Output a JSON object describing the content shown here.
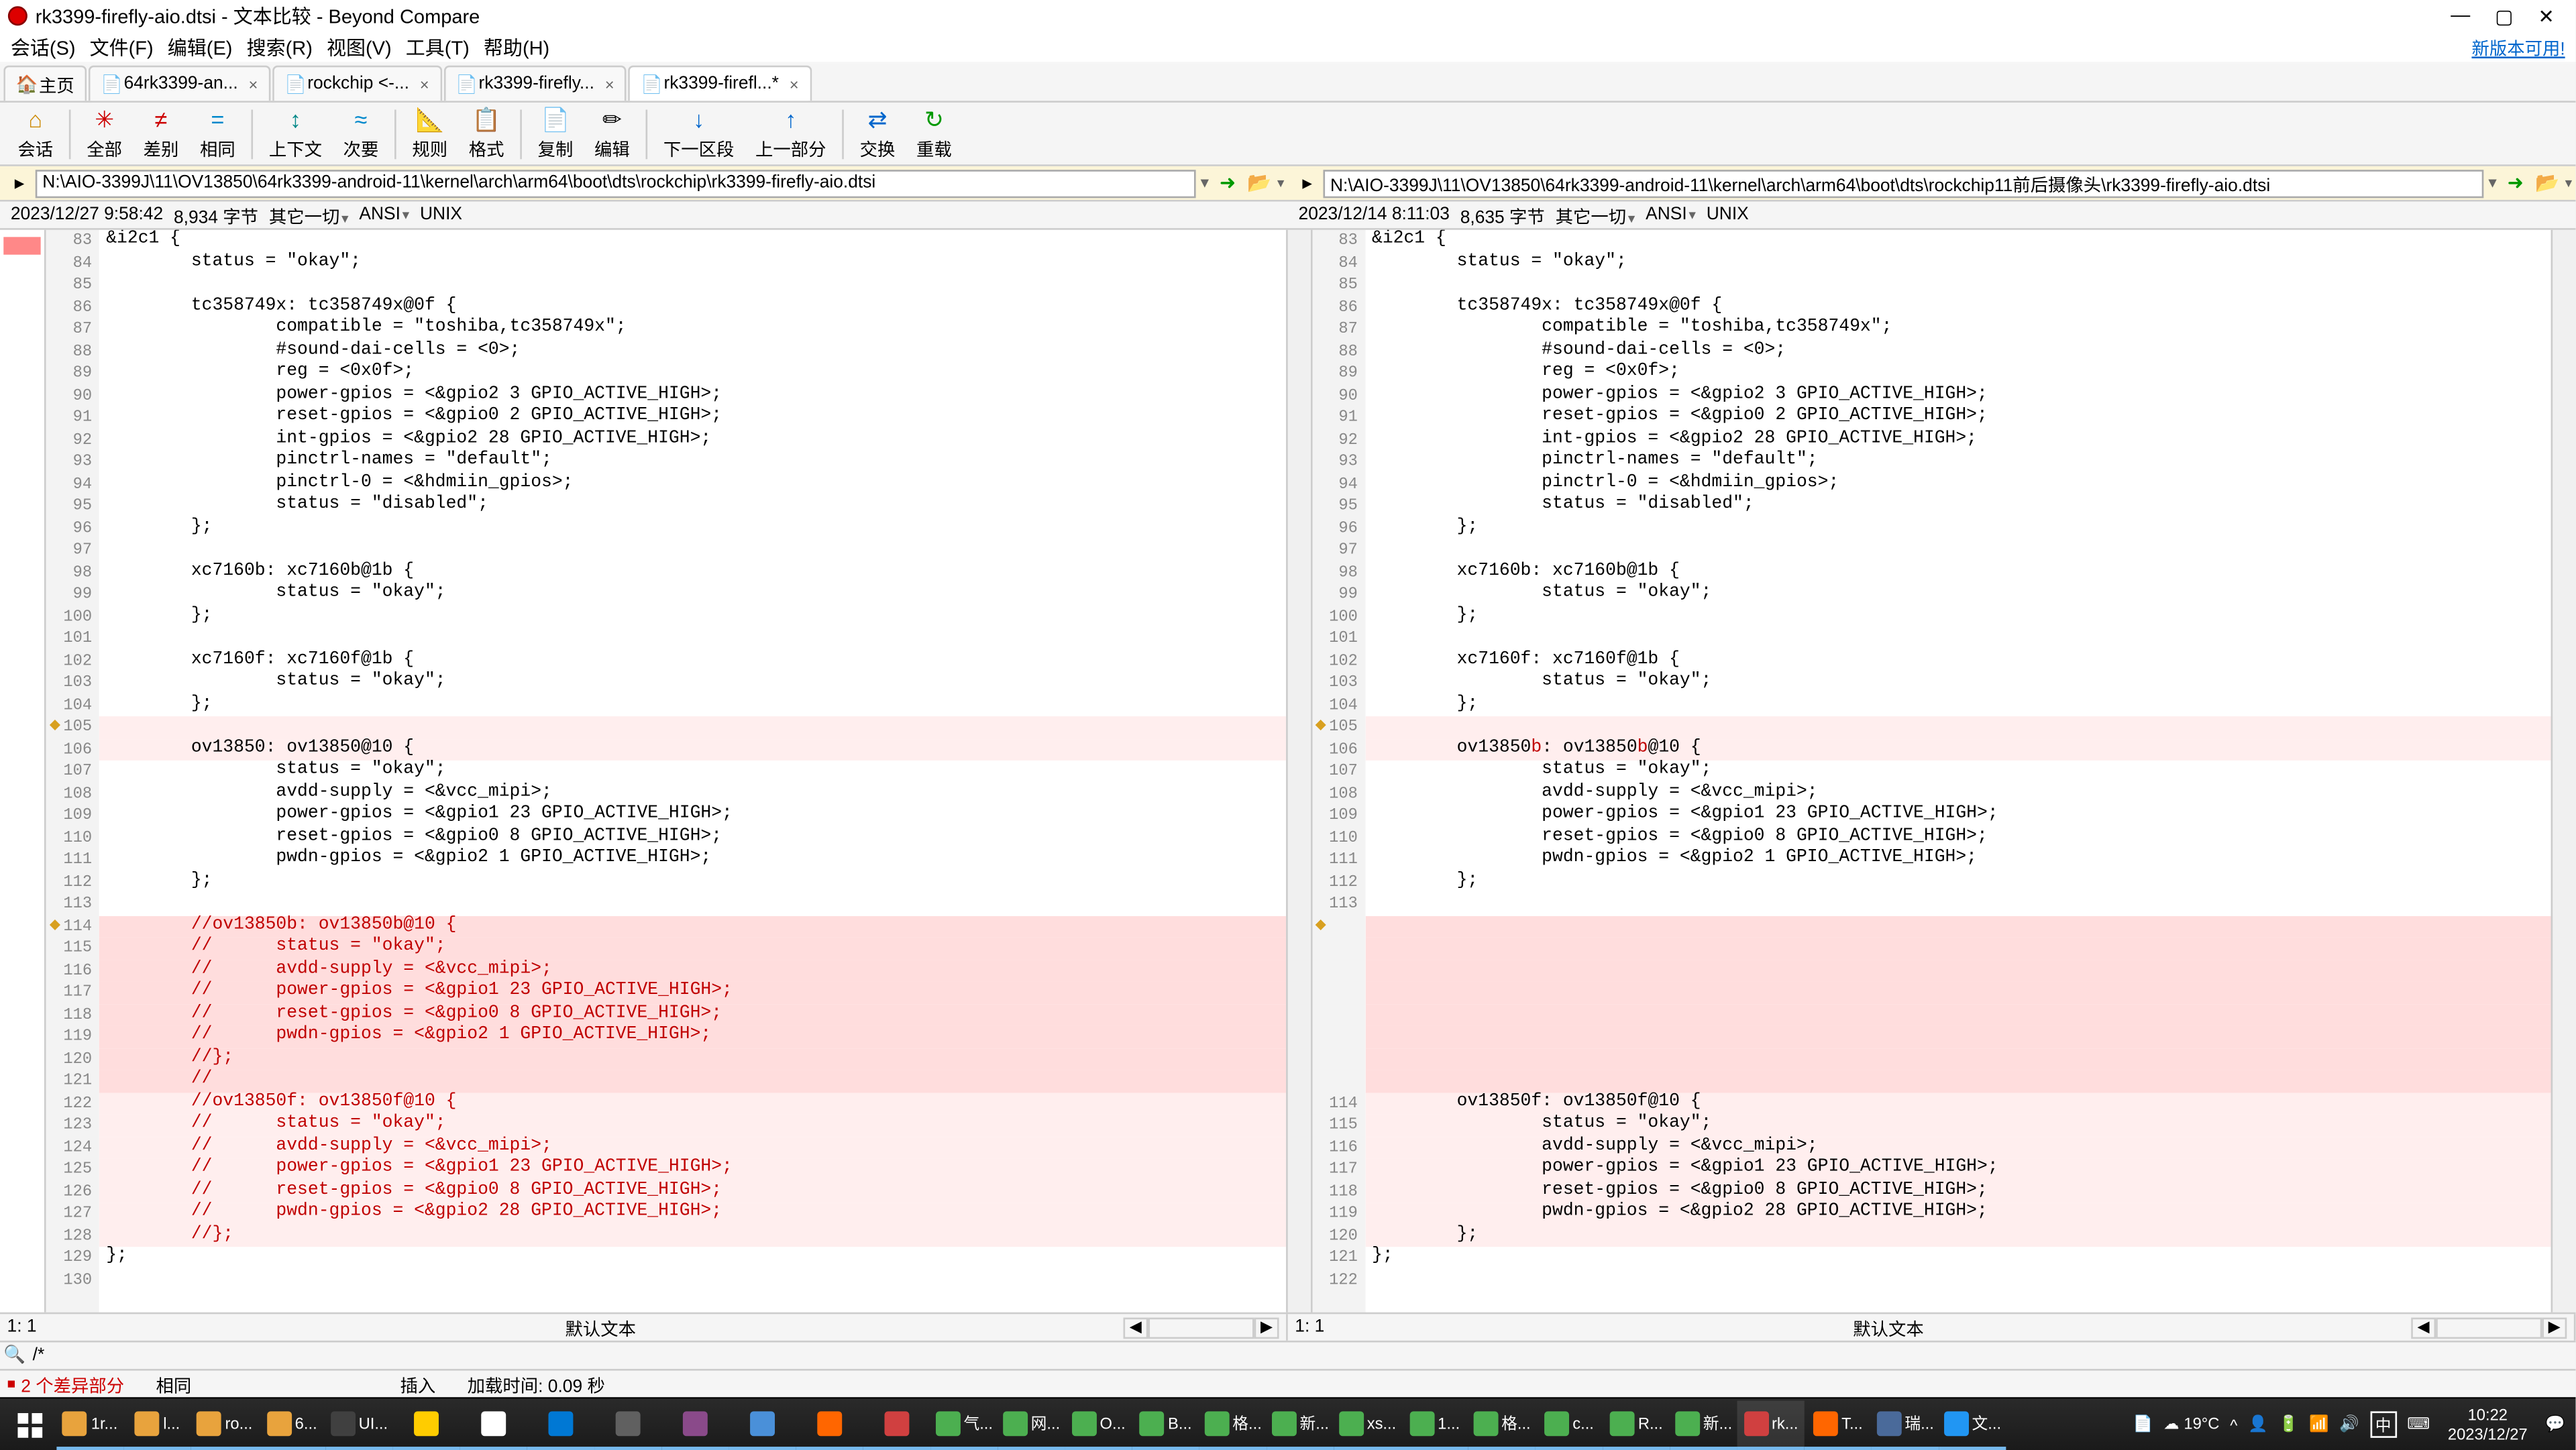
{
  "title": "rk3399-firefly-aio.dtsi - 文本比较 - Beyond Compare",
  "menu": {
    "session": "会话(S)",
    "file": "文件(F)",
    "edit": "编辑(E)",
    "search": "搜索(R)",
    "view": "视图(V)",
    "tools": "工具(T)",
    "help": "帮助(H)"
  },
  "newversion": "新版本可用!",
  "tabs": {
    "home": "主页",
    "t1": "64rk3399-an...",
    "t2": "rockchip <-...",
    "t3": "rk3399-firefly...",
    "t4": "rk3399-firefl...*"
  },
  "toolbar": {
    "session": "会话",
    "all": "全部",
    "diff": "差别",
    "same": "相同",
    "context": "上下文",
    "next": "次要",
    "rule": "规则",
    "format": "格式",
    "copy": "复制",
    "edit": "编辑",
    "nextsec": "下一区段",
    "prevsec": "上一部分",
    "swap": "交换",
    "reload": "重载"
  },
  "path": {
    "left": "N:\\AIO-3399J\\11\\OV13850\\64rk3399-android-11\\kernel\\arch\\arm64\\boot\\dts\\rockchip\\rk3399-firefly-aio.dtsi",
    "right": "N:\\AIO-3399J\\11\\OV13850\\64rk3399-android-11\\kernel\\arch\\arm64\\boot\\dts\\rockchip11前后摄像头\\rk3399-firefly-aio.dtsi"
  },
  "info": {
    "left_ts": "2023/12/27 9:58:42",
    "left_size": "8,934 字节",
    "left_other": "其它一切",
    "left_enc": "ANSI",
    "left_eol": "UNIX",
    "right_ts": "2023/12/14 8:11:03",
    "right_size": "8,635 字节",
    "right_other": "其它一切",
    "right_enc": "ANSI",
    "right_eol": "UNIX"
  },
  "bottom": {
    "pos": "1: 1",
    "mode": "默认文本"
  },
  "search": {
    "magnify": "🔍",
    "regex": "/*"
  },
  "status": {
    "diffcount": "2 个差异部分",
    "same": "相同",
    "insert": "插入",
    "loadtime": "加载时间: 0.09 秒"
  },
  "taskbar": {
    "items": [
      "1r...",
      "l...",
      "ro...",
      "6...",
      "UI...",
      "",
      "",
      "",
      "",
      "",
      "",
      "",
      "",
      "气...",
      "网...",
      "O...",
      "B...",
      "格...",
      "新...",
      "xs...",
      "1...",
      "格...",
      "c...",
      "R...",
      "新...",
      "rk...",
      "T...",
      "瑞...",
      "文..."
    ],
    "weather": "19°C",
    "ime": "中",
    "time": "10:22",
    "date": "2023/12/27"
  },
  "left_lines": [
    {
      "n": 83,
      "bg": "",
      "t": "&i2c1 {"
    },
    {
      "n": 84,
      "bg": "",
      "t": "        status = \"okay\";"
    },
    {
      "n": 85,
      "bg": "",
      "t": ""
    },
    {
      "n": 86,
      "bg": "",
      "t": "        tc358749x: tc358749x@0f {"
    },
    {
      "n": 87,
      "bg": "",
      "t": "                compatible = \"toshiba,tc358749x\";"
    },
    {
      "n": 88,
      "bg": "",
      "t": "                #sound-dai-cells = <0>;"
    },
    {
      "n": 89,
      "bg": "",
      "t": "                reg = <0x0f>;"
    },
    {
      "n": 90,
      "bg": "",
      "t": "                power-gpios = <&gpio2 3 GPIO_ACTIVE_HIGH>;"
    },
    {
      "n": 91,
      "bg": "",
      "t": "                reset-gpios = <&gpio0 2 GPIO_ACTIVE_HIGH>;"
    },
    {
      "n": 92,
      "bg": "",
      "t": "                int-gpios = <&gpio2 28 GPIO_ACTIVE_HIGH>;"
    },
    {
      "n": 93,
      "bg": "",
      "t": "                pinctrl-names = \"default\";"
    },
    {
      "n": 94,
      "bg": "",
      "t": "                pinctrl-0 = <&hdmiin_gpios>;"
    },
    {
      "n": 95,
      "bg": "",
      "t": "                status = \"disabled\";"
    },
    {
      "n": 96,
      "bg": "",
      "t": "        };"
    },
    {
      "n": 97,
      "bg": "",
      "t": ""
    },
    {
      "n": 98,
      "bg": "",
      "t": "        xc7160b: xc7160b@1b {"
    },
    {
      "n": 99,
      "bg": "",
      "t": "                status = \"okay\";"
    },
    {
      "n": 100,
      "bg": "",
      "t": "        };"
    },
    {
      "n": 101,
      "bg": "",
      "t": ""
    },
    {
      "n": 102,
      "bg": "",
      "t": "        xc7160f: xc7160f@1b {"
    },
    {
      "n": 103,
      "bg": "",
      "t": "                status = \"okay\";"
    },
    {
      "n": 104,
      "bg": "",
      "t": "        };"
    },
    {
      "n": 105,
      "bg": "bg-lightpink",
      "t": "",
      "mark": true
    },
    {
      "n": 106,
      "bg": "bg-lightpink",
      "t": "        ov13850: ov13850@10 {"
    },
    {
      "n": 107,
      "bg": "",
      "t": "                status = \"okay\";"
    },
    {
      "n": 108,
      "bg": "",
      "t": "                avdd-supply = <&vcc_mipi>;"
    },
    {
      "n": 109,
      "bg": "",
      "t": "                power-gpios = <&gpio1 23 GPIO_ACTIVE_HIGH>;"
    },
    {
      "n": 110,
      "bg": "",
      "t": "                reset-gpios = <&gpio0 8 GPIO_ACTIVE_HIGH>;"
    },
    {
      "n": 111,
      "bg": "",
      "t": "                pwdn-gpios = <&gpio2 1 GPIO_ACTIVE_HIGH>;"
    },
    {
      "n": 112,
      "bg": "",
      "t": "        };"
    },
    {
      "n": 113,
      "bg": "",
      "t": ""
    },
    {
      "n": 114,
      "bg": "bg-pink",
      "cls": "comment",
      "t": "        //ov13850b: ov13850b@10 {",
      "mark": true
    },
    {
      "n": 115,
      "bg": "bg-pink",
      "cls": "comment",
      "t": "        //      status = \"okay\";"
    },
    {
      "n": 116,
      "bg": "bg-pink",
      "cls": "comment",
      "t": "        //      avdd-supply = <&vcc_mipi>;"
    },
    {
      "n": 117,
      "bg": "bg-pink",
      "cls": "comment",
      "t": "        //      power-gpios = <&gpio1 23 GPIO_ACTIVE_HIGH>;"
    },
    {
      "n": 118,
      "bg": "bg-pink",
      "cls": "comment",
      "t": "        //      reset-gpios = <&gpio0 8 GPIO_ACTIVE_HIGH>;"
    },
    {
      "n": 119,
      "bg": "bg-pink",
      "cls": "comment",
      "t": "        //      pwdn-gpios = <&gpio2 1 GPIO_ACTIVE_HIGH>;"
    },
    {
      "n": 120,
      "bg": "bg-pink",
      "cls": "comment",
      "t": "        //};"
    },
    {
      "n": 121,
      "bg": "bg-pink",
      "cls": "comment",
      "t": "        //"
    },
    {
      "n": 122,
      "bg": "bg-lightpink",
      "cls": "comment",
      "t": "        //ov13850f: ov13850f@10 {"
    },
    {
      "n": 123,
      "bg": "bg-lightpink",
      "cls": "comment",
      "t": "        //      status = \"okay\";"
    },
    {
      "n": 124,
      "bg": "bg-lightpink",
      "cls": "comment",
      "t": "        //      avdd-supply = <&vcc_mipi>;"
    },
    {
      "n": 125,
      "bg": "bg-lightpink",
      "cls": "comment",
      "t": "        //      power-gpios = <&gpio1 23 GPIO_ACTIVE_HIGH>;"
    },
    {
      "n": 126,
      "bg": "bg-lightpink",
      "cls": "comment",
      "t": "        //      reset-gpios = <&gpio0 8 GPIO_ACTIVE_HIGH>;"
    },
    {
      "n": 127,
      "bg": "bg-lightpink",
      "cls": "comment",
      "t": "        //      pwdn-gpios = <&gpio2 28 GPIO_ACTIVE_HIGH>;"
    },
    {
      "n": 128,
      "bg": "bg-lightpink",
      "cls": "comment",
      "t": "        //};"
    },
    {
      "n": 129,
      "bg": "",
      "t": "};"
    },
    {
      "n": 130,
      "bg": "",
      "t": ""
    }
  ],
  "right_lines": [
    {
      "n": 83,
      "bg": "",
      "t": "&i2c1 {"
    },
    {
      "n": 84,
      "bg": "",
      "t": "        status = \"okay\";"
    },
    {
      "n": 85,
      "bg": "",
      "t": ""
    },
    {
      "n": 86,
      "bg": "",
      "t": "        tc358749x: tc358749x@0f {"
    },
    {
      "n": 87,
      "bg": "",
      "t": "                compatible = \"toshiba,tc358749x\";"
    },
    {
      "n": 88,
      "bg": "",
      "t": "                #sound-dai-cells = <0>;"
    },
    {
      "n": 89,
      "bg": "",
      "t": "                reg = <0x0f>;"
    },
    {
      "n": 90,
      "bg": "",
      "t": "                power-gpios = <&gpio2 3 GPIO_ACTIVE_HIGH>;"
    },
    {
      "n": 91,
      "bg": "",
      "t": "                reset-gpios = <&gpio0 2 GPIO_ACTIVE_HIGH>;"
    },
    {
      "n": 92,
      "bg": "",
      "t": "                int-gpios = <&gpio2 28 GPIO_ACTIVE_HIGH>;"
    },
    {
      "n": 93,
      "bg": "",
      "t": "                pinctrl-names = \"default\";"
    },
    {
      "n": 94,
      "bg": "",
      "t": "                pinctrl-0 = <&hdmiin_gpios>;"
    },
    {
      "n": 95,
      "bg": "",
      "t": "                status = \"disabled\";"
    },
    {
      "n": 96,
      "bg": "",
      "t": "        };"
    },
    {
      "n": 97,
      "bg": "",
      "t": ""
    },
    {
      "n": 98,
      "bg": "",
      "t": "        xc7160b: xc7160b@1b {"
    },
    {
      "n": 99,
      "bg": "",
      "t": "                status = \"okay\";"
    },
    {
      "n": 100,
      "bg": "",
      "t": "        };"
    },
    {
      "n": 101,
      "bg": "",
      "t": ""
    },
    {
      "n": 102,
      "bg": "",
      "t": "        xc7160f: xc7160f@1b {"
    },
    {
      "n": 103,
      "bg": "",
      "t": "                status = \"okay\";"
    },
    {
      "n": 104,
      "bg": "",
      "t": "        };"
    },
    {
      "n": 105,
      "bg": "bg-lightpink",
      "t": "",
      "mark": true
    },
    {
      "n": 106,
      "bg": "bg-lightpink",
      "t": "        ov13850<span class=\"reddiff\">b</span>: ov13850<span class=\"reddiff\">b</span>@10 {",
      "html": true
    },
    {
      "n": 107,
      "bg": "",
      "t": "                status = \"okay\";"
    },
    {
      "n": 108,
      "bg": "",
      "t": "                avdd-supply = <&vcc_mipi>;"
    },
    {
      "n": 109,
      "bg": "",
      "t": "                power-gpios = <&gpio1 23 GPIO_ACTIVE_HIGH>;"
    },
    {
      "n": 110,
      "bg": "",
      "t": "                reset-gpios = <&gpio0 8 GPIO_ACTIVE_HIGH>;"
    },
    {
      "n": 111,
      "bg": "",
      "t": "                pwdn-gpios = <&gpio2 1 GPIO_ACTIVE_HIGH>;"
    },
    {
      "n": 112,
      "bg": "",
      "t": "        };"
    },
    {
      "n": 113,
      "bg": "",
      "t": ""
    },
    {
      "n": "",
      "bg": "bg-pink",
      "t": "",
      "mark": true
    },
    {
      "n": "",
      "bg": "bg-pink",
      "t": ""
    },
    {
      "n": "",
      "bg": "bg-pink",
      "t": ""
    },
    {
      "n": "",
      "bg": "bg-pink",
      "t": ""
    },
    {
      "n": "",
      "bg": "bg-pink",
      "t": ""
    },
    {
      "n": "",
      "bg": "bg-pink",
      "t": ""
    },
    {
      "n": "",
      "bg": "bg-pink",
      "t": ""
    },
    {
      "n": "",
      "bg": "bg-pink",
      "t": ""
    },
    {
      "n": 114,
      "bg": "bg-lightpink",
      "t": "        ov13850f: ov13850f@10 {"
    },
    {
      "n": 115,
      "bg": "bg-lightpink",
      "t": "                status = \"okay\";"
    },
    {
      "n": 116,
      "bg": "bg-lightpink",
      "t": "                avdd-supply = <&vcc_mipi>;"
    },
    {
      "n": 117,
      "bg": "bg-lightpink",
      "t": "                power-gpios = <&gpio1 23 GPIO_ACTIVE_HIGH>;"
    },
    {
      "n": 118,
      "bg": "bg-lightpink",
      "t": "                reset-gpios = <&gpio0 8 GPIO_ACTIVE_HIGH>;"
    },
    {
      "n": 119,
      "bg": "bg-lightpink",
      "t": "                pwdn-gpios = <&gpio2 28 GPIO_ACTIVE_HIGH>;"
    },
    {
      "n": 120,
      "bg": "bg-lightpink",
      "t": "        };"
    },
    {
      "n": 121,
      "bg": "",
      "t": "};"
    },
    {
      "n": 122,
      "bg": "",
      "t": ""
    }
  ]
}
